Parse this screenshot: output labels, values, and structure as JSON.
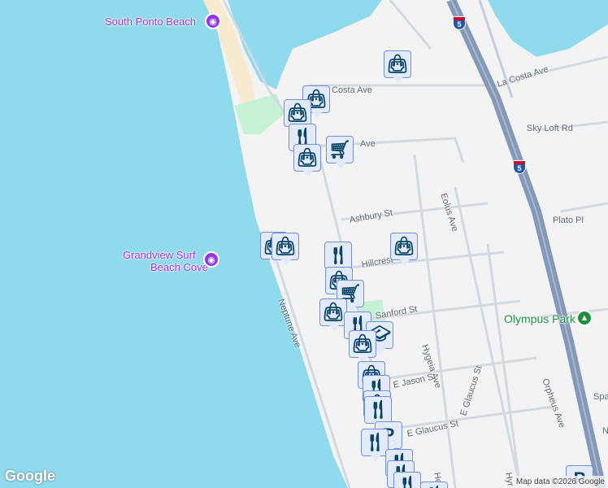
{
  "pois": [
    {
      "name": "South Ponto Beach",
      "color": "#9334e6",
      "icon": "camera-icon"
    },
    {
      "name": "Grandview Surf",
      "name2": "Beach Cove",
      "color": "#9334e6",
      "icon": "camera-icon"
    },
    {
      "name": "Olympus Park",
      "color": "#1e8e3e",
      "icon": "tree-icon"
    }
  ],
  "streets": {
    "la_costa_ave": "La Costa Ave",
    "costa_ave": "Costa Ave",
    "ave": "Ave",
    "sky_loft": "Sky Loft Rd",
    "eolus": "Eolus Ave",
    "ashbury": "Ashbury St",
    "plato": "Plato Pl",
    "hillcrest": "Hillcrest",
    "sanford": "Sanford St",
    "hygeia": "Hygeia Ave",
    "jason": "E Jason St",
    "glaucus_v": "E Glaucus St",
    "glaucus_h": "E Glaucus St",
    "orpheus": "Orpheus Ave",
    "neptune": "Neptune Ave",
    "herr": "Herr",
    "hyr": "Hyr",
    "eo": "Eo",
    "spa": "Spa",
    "n": "N"
  },
  "highway": "5",
  "footer": {
    "logo": "Google",
    "attribution": "Map data ©2026 Google"
  },
  "colors": {
    "water": "#8fdaec",
    "land": "#f4f3f4",
    "marker_bg": "#e3ebfb",
    "marker_icon": "#0b4566",
    "highway": "#8499b8"
  }
}
